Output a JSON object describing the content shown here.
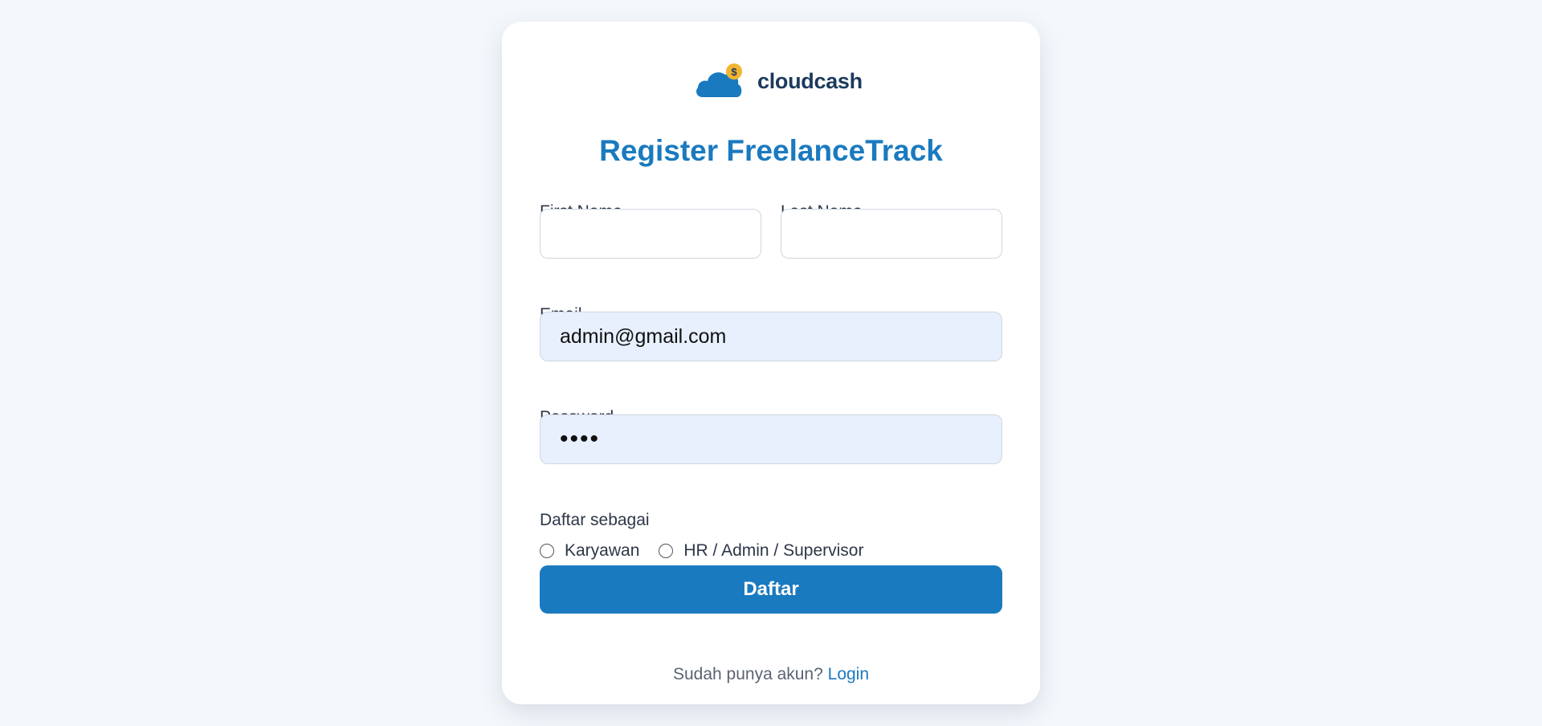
{
  "brand": {
    "name": "cloudcash",
    "logo_icon": "cloud-coin-icon",
    "accent": "#1a7abf",
    "coin": "#f2b530"
  },
  "page_title": "Register FreelanceTrack",
  "form": {
    "first_name_label": "First Name",
    "first_name_value": "",
    "last_name_label": "Last Name",
    "last_name_value": "",
    "email_label": "Email",
    "email_value": "admin@gmail.com",
    "password_label": "Password",
    "password_value": "••••",
    "role_label": "Daftar sebagai",
    "role_options": [
      "Karyawan",
      "HR / Admin / Supervisor"
    ],
    "submit_label": "Daftar"
  },
  "footer": {
    "prompt": "Sudah punya akun?",
    "link": "Login"
  }
}
